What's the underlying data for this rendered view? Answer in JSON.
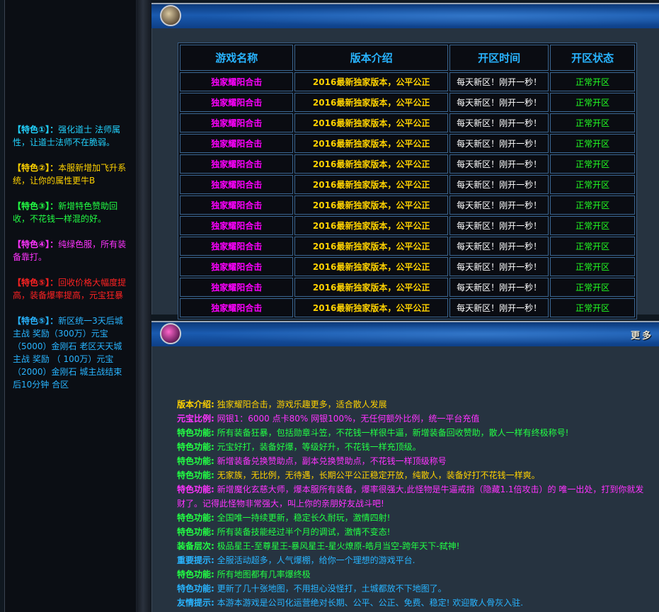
{
  "sidebar": {
    "features": [
      {
        "label": "【特色①】：",
        "text": "强化道士 法师属性，让道士法师不在脆弱。",
        "color": "#22d3ff",
        "label_color": "#22d3ff"
      },
      {
        "label": "【特色②】：",
        "text": "本服新增加飞升系统，让你的属性更牛B",
        "color": "#ffd200",
        "label_color": "#ffd200"
      },
      {
        "label": "【特色③】：",
        "text": "新增特色赞助回收，不花钱一样混的好。",
        "color": "#22ff44",
        "label_color": "#22ff44"
      },
      {
        "label": "【特色④】：",
        "text": "纯绿色服，所有装备靠打。",
        "color": "#ff33ff",
        "label_color": "#ff33ff"
      },
      {
        "label": "【特色⑤】：",
        "text": "回收价格大幅度提高，装备爆率提高，元宝狂暴",
        "color": "#ff2222",
        "label_color": "#ff2222"
      },
      {
        "label": "【特色⑤】：",
        "text": "新区统一3天后城主战 奖励（300万）元宝 （5000）金刚石 老区天天城主战 奖励 （ 100万）元宝 （2000）金刚石 城主战结束后10分钟 合区",
        "color": "#28b4ff",
        "label_color": "#28b4ff"
      }
    ]
  },
  "bottom_panel": {
    "more_label": "更多"
  },
  "server_table": {
    "headers": [
      "游戏名称",
      "版本介绍",
      "开区时间",
      "开区状态"
    ],
    "rows": [
      {
        "name": "独家耀阳合击",
        "version": "2016最新独家版本，公平公正",
        "time": "每天新区！刚开一秒！",
        "status": "正常开区"
      },
      {
        "name": "独家耀阳合击",
        "version": "2016最新独家版本，公平公正",
        "time": "每天新区！刚开一秒！",
        "status": "正常开区"
      },
      {
        "name": "独家耀阳合击",
        "version": "2016最新独家版本，公平公正",
        "time": "每天新区！刚开一秒！",
        "status": "正常开区"
      },
      {
        "name": "独家耀阳合击",
        "version": "2016最新独家版本，公平公正",
        "time": "每天新区！刚开一秒！",
        "status": "正常开区"
      },
      {
        "name": "独家耀阳合击",
        "version": "2016最新独家版本，公平公正",
        "time": "每天新区！刚开一秒！",
        "status": "正常开区"
      },
      {
        "name": "独家耀阳合击",
        "version": "2016最新独家版本，公平公正",
        "time": "每天新区！刚开一秒！",
        "status": "正常开区"
      },
      {
        "name": "独家耀阳合击",
        "version": "2016最新独家版本，公平公正",
        "time": "每天新区！刚开一秒！",
        "status": "正常开区"
      },
      {
        "name": "独家耀阳合击",
        "version": "2016最新独家版本，公平公正",
        "time": "每天新区！刚开一秒！",
        "status": "正常开区"
      },
      {
        "name": "独家耀阳合击",
        "version": "2016最新独家版本，公平公正",
        "time": "每天新区！刚开一秒！",
        "status": "正常开区"
      },
      {
        "name": "独家耀阳合击",
        "version": "2016最新独家版本，公平公正",
        "time": "每天新区！刚开一秒！",
        "status": "正常开区"
      },
      {
        "name": "独家耀阳合击",
        "version": "2016最新独家版本，公平公正",
        "time": "每天新区！刚开一秒！",
        "status": "正常开区"
      },
      {
        "name": "独家耀阳合击",
        "version": "2016最新独家版本，公平公正",
        "time": "每天新区！刚开一秒！",
        "status": "正常开区"
      }
    ]
  },
  "info_lines": [
    {
      "label": "版本介绍:",
      "text": "独家耀阳合击，游戏乐趣更多，适合散人发展",
      "label_color": "#ffd200",
      "color": "#ffd200"
    },
    {
      "label": "元宝比例:",
      "text": "网银1：6000 点卡80% 网银100%，无任何额外比例，统一平台充值",
      "label_color": "#ff33ff",
      "color": "#ff33ff"
    },
    {
      "label": "特色功能:",
      "text": "所有装备狂暴，包括勋章斗笠，不花钱一样很牛逼，新增装备回收赞助，散人一样有终极称号!",
      "label_color": "#22ff44",
      "color": "#22ff44"
    },
    {
      "label": "特色功能:",
      "text": "元宝好打，装备好爆，等级好升，不花钱一样充顶级。",
      "label_color": "#22ff44",
      "color": "#22ff44"
    },
    {
      "label": "特色功能:",
      "text": "新增装备兑换赞助点，副本兑换赞助点，不花钱一样顶级称号",
      "label_color": "#22ff44",
      "color": "#ff33ff"
    },
    {
      "label": "特色功能:",
      "text": "无家族，无比例，无待遇，长期公平公正稳定开放，纯散人，装备好打不花钱一样爽。",
      "label_color": "#22ff44",
      "color": "#ffd200"
    },
    {
      "label": "特色功能:",
      "text": "新增魔化玄慈大师，爆本服所有装备，爆率很强大,此怪物是牛逼戒指（隐藏1.1倍攻击）的 唯一出处，打到你就发财了。记得此怪物非常强大，叫上你的亲朋好友战斗吧!",
      "label_color": "#ff33ff",
      "color": "#ff33ff"
    },
    {
      "label": "特色功能:",
      "text": "全国唯一持续更新，稳定长久耐玩，激情四射!",
      "label_color": "#22ff44",
      "color": "#22ff44"
    },
    {
      "label": "特色功能:",
      "text": "所有装备技能经过半个月的调试，激情不变态!",
      "label_color": "#22ff44",
      "color": "#22ff44"
    },
    {
      "label": "装备层次:",
      "text": "极品星王-至尊星王-暴风星王-星火燎原-皓月当空-跨年天下-弑神!",
      "label_color": "#22ff44",
      "color": "#22ff44"
    },
    {
      "label": "重要提示:",
      "text": "全服活动超多，人气爆棚，给你一个理想的游戏平台.",
      "label_color": "#28b4ff",
      "color": "#28b4ff"
    },
    {
      "label": "特色功能:",
      "text": "所有地图都有几率爆终极",
      "label_color": "#22ff44",
      "color": "#22ff44"
    },
    {
      "label": "特色功能:",
      "text": "更新了几十张地图，不用担心没怪打，土城都放不下地图了。",
      "label_color": "#28b4ff",
      "color": "#28b4ff"
    },
    {
      "label": "友情提示:",
      "text": "本游本游戏是公司化运营绝对长期、公平、公正、免费、稳定! 欢迎散人骨灰入驻.",
      "label_color": "#28b4ff",
      "color": "#28b4ff"
    }
  ]
}
